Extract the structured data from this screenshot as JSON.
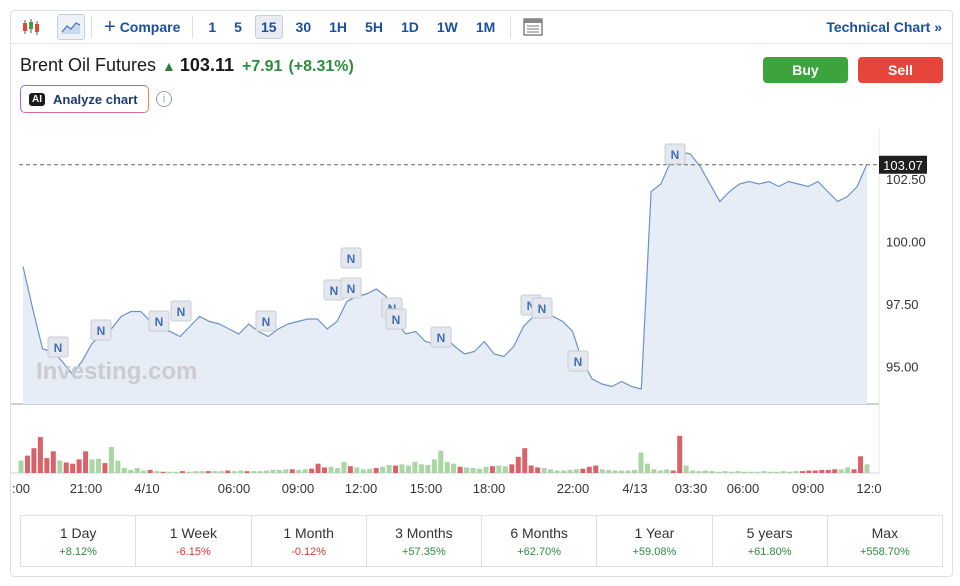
{
  "toolbar": {
    "compare_label": "Compare",
    "intervals": [
      "1",
      "5",
      "15",
      "30",
      "1H",
      "5H",
      "1D",
      "1W",
      "1M"
    ],
    "active_interval": "15",
    "technical_label": "Technical Chart »"
  },
  "header": {
    "title": "Brent Oil Futures",
    "price": "103.11",
    "change": "+7.91",
    "change_pct": "(+8.31%)",
    "analyze_label": "Analyze chart",
    "ai_badge": "AI",
    "info_symbol": "i",
    "buy_label": "Buy",
    "sell_label": "Sell"
  },
  "colors": {
    "line": "#6b93c9",
    "area": "#e6edf6",
    "vol_up": "#a9d6a3",
    "vol_down": "#d9626a",
    "buy": "#3da33d",
    "sell": "#e5453a",
    "accent": "#1b4fa1"
  },
  "chart_data": {
    "type": "area",
    "watermark": "Investing.com",
    "x_tick_labels": [
      ":00",
      "21:00",
      "4/10",
      "06:00",
      "09:00",
      "12:00",
      "15:00",
      "18:00",
      "22:00",
      "4/13",
      "03:30",
      "06:00",
      "09:00",
      "12:0"
    ],
    "y_ticks": [
      "95.00",
      "97.50",
      "100.00",
      "102.50"
    ],
    "ylim": [
      93.5,
      104.5
    ],
    "last_price_label": "103.07",
    "last_price": 103.07,
    "news_marker_label": "N",
    "values": [
      99.0,
      97.3,
      95.7,
      95.6,
      95.2,
      94.7,
      95.2,
      95.9,
      96.3,
      96.5,
      97.0,
      97.2,
      97.2,
      96.8,
      96.5,
      96.4,
      96.2,
      96.6,
      97.0,
      96.8,
      96.7,
      96.5,
      96.3,
      96.7,
      96.4,
      96.2,
      96.5,
      96.7,
      96.8,
      96.9,
      96.9,
      96.5,
      96.8,
      97.6,
      97.8,
      97.9,
      98.1,
      97.8,
      96.8,
      96.3,
      96.4,
      96.0,
      95.9,
      96.2,
      95.8,
      95.5,
      95.6,
      96.0,
      95.5,
      95.4,
      95.8,
      96.6,
      97.0,
      97.1,
      97.0,
      96.8,
      96.4,
      95.2,
      94.5,
      94.3,
      94.2,
      94.4,
      94.2,
      94.1,
      102.0,
      102.3,
      103.2,
      103.6,
      103.5,
      103.0,
      102.3,
      101.6,
      102.0,
      102.3,
      102.4,
      102.3,
      102.4,
      102.2,
      102.4,
      102.3,
      102.2,
      102.4,
      102.0,
      101.6,
      101.8,
      102.2,
      103.1
    ],
    "volume_bar_heights_rel": [
      0.2,
      0.28,
      0.4,
      0.58,
      0.24,
      0.35,
      0.2,
      0.17,
      0.15,
      0.22,
      0.35,
      0.22,
      0.23,
      0.16,
      0.42,
      0.2,
      0.08,
      0.05,
      0.08,
      0.04,
      0.05,
      0.03,
      0.02,
      0.02,
      0.02,
      0.03,
      0.02,
      0.03,
      0.03,
      0.03,
      0.03,
      0.03,
      0.04,
      0.03,
      0.04,
      0.03,
      0.03,
      0.03,
      0.04,
      0.05,
      0.05,
      0.06,
      0.06,
      0.05,
      0.06,
      0.07,
      0.15,
      0.09,
      0.1,
      0.08,
      0.18,
      0.11,
      0.09,
      0.06,
      0.07,
      0.08,
      0.1,
      0.13,
      0.12,
      0.14,
      0.12,
      0.18,
      0.14,
      0.13,
      0.22,
      0.36,
      0.18,
      0.15,
      0.1,
      0.09,
      0.08,
      0.07,
      0.1,
      0.11,
      0.12,
      0.11,
      0.14,
      0.26,
      0.4,
      0.12,
      0.09,
      0.08,
      0.06,
      0.04,
      0.04,
      0.05,
      0.06,
      0.07,
      0.1,
      0.12,
      0.06,
      0.05,
      0.04,
      0.04,
      0.04,
      0.05,
      0.33,
      0.15,
      0.06,
      0.04,
      0.06,
      0.04,
      0.6,
      0.12,
      0.04,
      0.03,
      0.04,
      0.03,
      0.02,
      0.03,
      0.02,
      0.03,
      0.02,
      0.02,
      0.02,
      0.03,
      0.02,
      0.02,
      0.03,
      0.02,
      0.03,
      0.03,
      0.04,
      0.04,
      0.05,
      0.05,
      0.06,
      0.06,
      0.09,
      0.06,
      0.27,
      0.14
    ],
    "volume_bar_down": [
      0,
      1,
      1,
      1,
      1,
      1,
      0,
      1,
      1,
      1,
      1,
      0,
      0,
      1,
      0,
      0,
      0,
      0,
      0,
      0,
      1,
      0,
      1,
      0,
      0,
      1,
      0,
      0,
      0,
      1,
      0,
      0,
      1,
      0,
      0,
      1,
      0,
      0,
      0,
      0,
      0,
      0,
      1,
      0,
      0,
      1,
      1,
      1,
      0,
      0,
      0,
      1,
      0,
      0,
      0,
      1,
      0,
      0,
      1,
      0,
      0,
      0,
      0,
      0,
      0,
      0,
      0,
      0,
      1,
      0,
      0,
      0,
      0,
      1,
      0,
      0,
      1,
      1,
      1,
      1,
      1,
      0,
      0,
      0,
      0,
      0,
      0,
      1,
      1,
      1,
      0,
      0,
      0,
      0,
      0,
      0,
      0,
      0,
      0,
      0,
      0,
      1,
      1,
      0,
      0,
      0,
      0,
      0,
      0,
      0,
      0,
      0,
      0,
      0,
      0,
      0,
      0,
      0,
      0,
      0,
      0,
      1,
      1,
      1,
      1,
      1,
      1,
      0,
      0,
      1,
      1
    ]
  },
  "performance": [
    {
      "label": "1 Day",
      "value": "+8.12%",
      "dir": "pos"
    },
    {
      "label": "1 Week",
      "value": "-6.15%",
      "dir": "neg"
    },
    {
      "label": "1 Month",
      "value": "-0.12%",
      "dir": "neg"
    },
    {
      "label": "3 Months",
      "value": "+57.35%",
      "dir": "pos"
    },
    {
      "label": "6 Months",
      "value": "+62.70%",
      "dir": "pos"
    },
    {
      "label": "1 Year",
      "value": "+59.08%",
      "dir": "pos"
    },
    {
      "label": "5 years",
      "value": "+61.80%",
      "dir": "pos"
    },
    {
      "label": "Max",
      "value": "+558.70%",
      "dir": "pos"
    }
  ]
}
